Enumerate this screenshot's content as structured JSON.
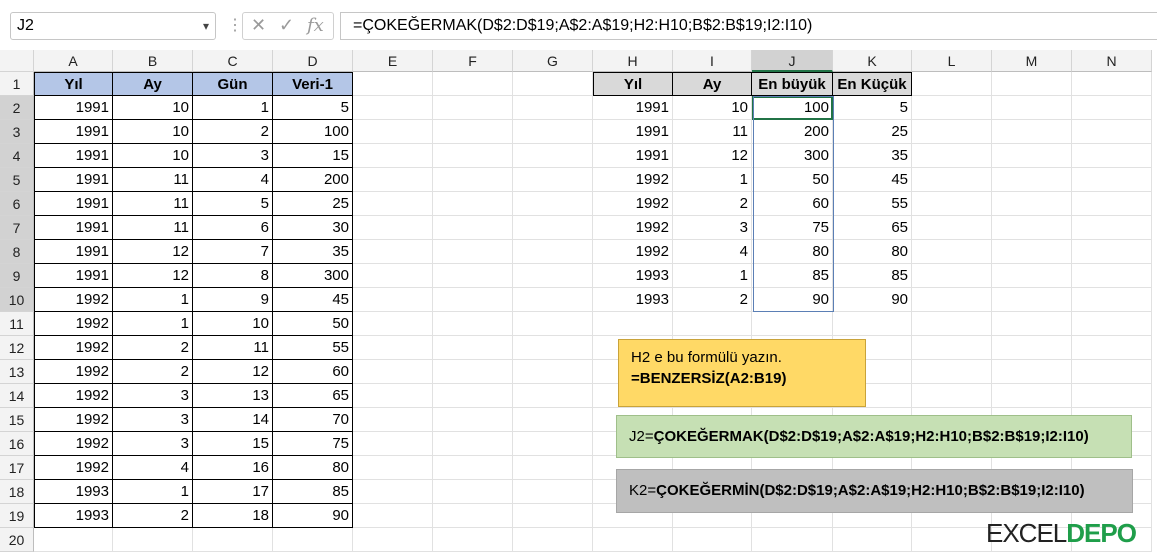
{
  "formula_bar": {
    "name_box": "J2",
    "formula": "=ÇOKEĞERMAK(D$2:D$19;A$2:A$19;H2:H10;B$2:B$19;I2:I10)",
    "fx_label": "fx"
  },
  "columns": [
    "A",
    "B",
    "C",
    "D",
    "E",
    "F",
    "G",
    "H",
    "I",
    "J",
    "K",
    "L",
    "M",
    "N"
  ],
  "rows": [
    "1",
    "2",
    "3",
    "4",
    "5",
    "6",
    "7",
    "8",
    "9",
    "10",
    "11",
    "12",
    "13",
    "14",
    "15",
    "16",
    "17",
    "18",
    "19",
    "20"
  ],
  "left_table": {
    "headers": [
      "Yıl",
      "Ay",
      "Gün",
      "Veri-1"
    ],
    "rows": [
      [
        "1991",
        "10",
        "1",
        "5"
      ],
      [
        "1991",
        "10",
        "2",
        "100"
      ],
      [
        "1991",
        "10",
        "3",
        "15"
      ],
      [
        "1991",
        "11",
        "4",
        "200"
      ],
      [
        "1991",
        "11",
        "5",
        "25"
      ],
      [
        "1991",
        "11",
        "6",
        "30"
      ],
      [
        "1991",
        "12",
        "7",
        "35"
      ],
      [
        "1991",
        "12",
        "8",
        "300"
      ],
      [
        "1992",
        "1",
        "9",
        "45"
      ],
      [
        "1992",
        "1",
        "10",
        "50"
      ],
      [
        "1992",
        "2",
        "11",
        "55"
      ],
      [
        "1992",
        "2",
        "12",
        "60"
      ],
      [
        "1992",
        "3",
        "13",
        "65"
      ],
      [
        "1992",
        "3",
        "14",
        "70"
      ],
      [
        "1992",
        "3",
        "15",
        "75"
      ],
      [
        "1992",
        "4",
        "16",
        "80"
      ],
      [
        "1993",
        "1",
        "17",
        "85"
      ],
      [
        "1993",
        "2",
        "18",
        "90"
      ]
    ]
  },
  "right_table": {
    "headers": [
      "Yıl",
      "Ay",
      "En büyük",
      "En Küçük"
    ],
    "rows": [
      [
        "1991",
        "10",
        "100",
        "5"
      ],
      [
        "1991",
        "11",
        "200",
        "25"
      ],
      [
        "1991",
        "12",
        "300",
        "35"
      ],
      [
        "1992",
        "1",
        "50",
        "45"
      ],
      [
        "1992",
        "2",
        "60",
        "55"
      ],
      [
        "1992",
        "3",
        "75",
        "65"
      ],
      [
        "1992",
        "4",
        "80",
        "80"
      ],
      [
        "1993",
        "1",
        "85",
        "85"
      ],
      [
        "1993",
        "2",
        "90",
        "90"
      ]
    ]
  },
  "notes": {
    "note1_line1": "H2 e bu formülü yazın.",
    "note1_line2": "=BENZERSİZ(A2:B19)",
    "note2_prefix": "J2=",
    "note2_formula": "ÇOKEĞERMAK(D$2:D$19;A$2:A$19;H2:H10;B$2:B$19;I2:I10)",
    "note3_prefix": "K2=",
    "note3_formula": "ÇOKEĞERMİN(D$2:D$19;A$2:A$19;H2:H10;B$2:B$19;I2:I10)"
  },
  "logo": {
    "part1": "EXCEL",
    "part2": "DEPO"
  }
}
